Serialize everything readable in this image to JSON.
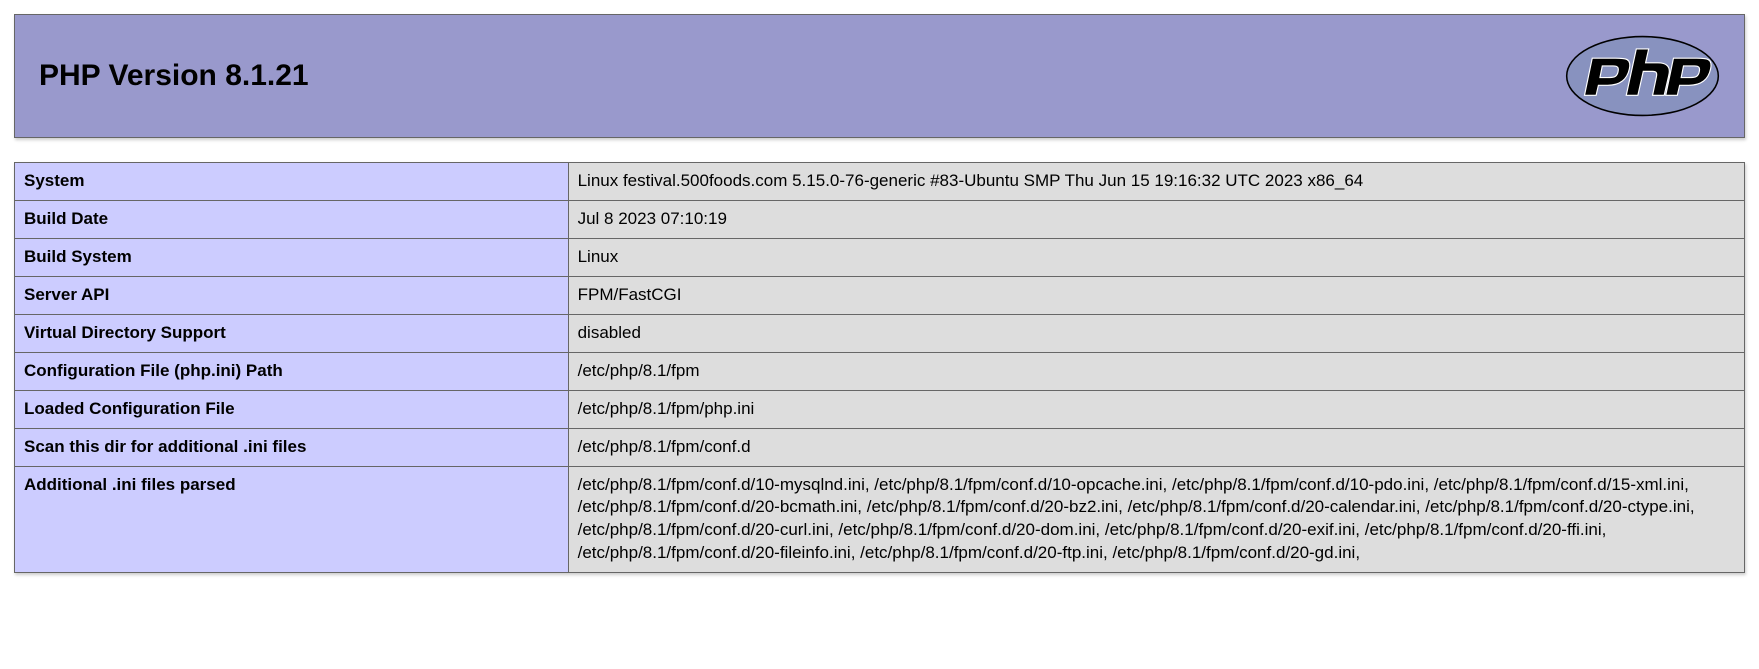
{
  "header": {
    "title": "PHP Version 8.1.21"
  },
  "rows": [
    {
      "label": "System",
      "value": "Linux festival.500foods.com 5.15.0-76-generic #83-Ubuntu SMP Thu Jun 15 19:16:32 UTC 2023 x86_64"
    },
    {
      "label": "Build Date",
      "value": "Jul 8 2023 07:10:19"
    },
    {
      "label": "Build System",
      "value": "Linux"
    },
    {
      "label": "Server API",
      "value": "FPM/FastCGI"
    },
    {
      "label": "Virtual Directory Support",
      "value": "disabled"
    },
    {
      "label": "Configuration File (php.ini) Path",
      "value": "/etc/php/8.1/fpm"
    },
    {
      "label": "Loaded Configuration File",
      "value": "/etc/php/8.1/fpm/php.ini"
    },
    {
      "label": "Scan this dir for additional .ini files",
      "value": "/etc/php/8.1/fpm/conf.d"
    },
    {
      "label": "Additional .ini files parsed",
      "value": "/etc/php/8.1/fpm/conf.d/10-mysqlnd.ini, /etc/php/8.1/fpm/conf.d/10-opcache.ini, /etc/php/8.1/fpm/conf.d/10-pdo.ini, /etc/php/8.1/fpm/conf.d/15-xml.ini, /etc/php/8.1/fpm/conf.d/20-bcmath.ini, /etc/php/8.1/fpm/conf.d/20-bz2.ini, /etc/php/8.1/fpm/conf.d/20-calendar.ini, /etc/php/8.1/fpm/conf.d/20-ctype.ini, /etc/php/8.1/fpm/conf.d/20-curl.ini, /etc/php/8.1/fpm/conf.d/20-dom.ini, /etc/php/8.1/fpm/conf.d/20-exif.ini, /etc/php/8.1/fpm/conf.d/20-ffi.ini, /etc/php/8.1/fpm/conf.d/20-fileinfo.ini, /etc/php/8.1/fpm/conf.d/20-ftp.ini, /etc/php/8.1/fpm/conf.d/20-gd.ini,"
    }
  ]
}
